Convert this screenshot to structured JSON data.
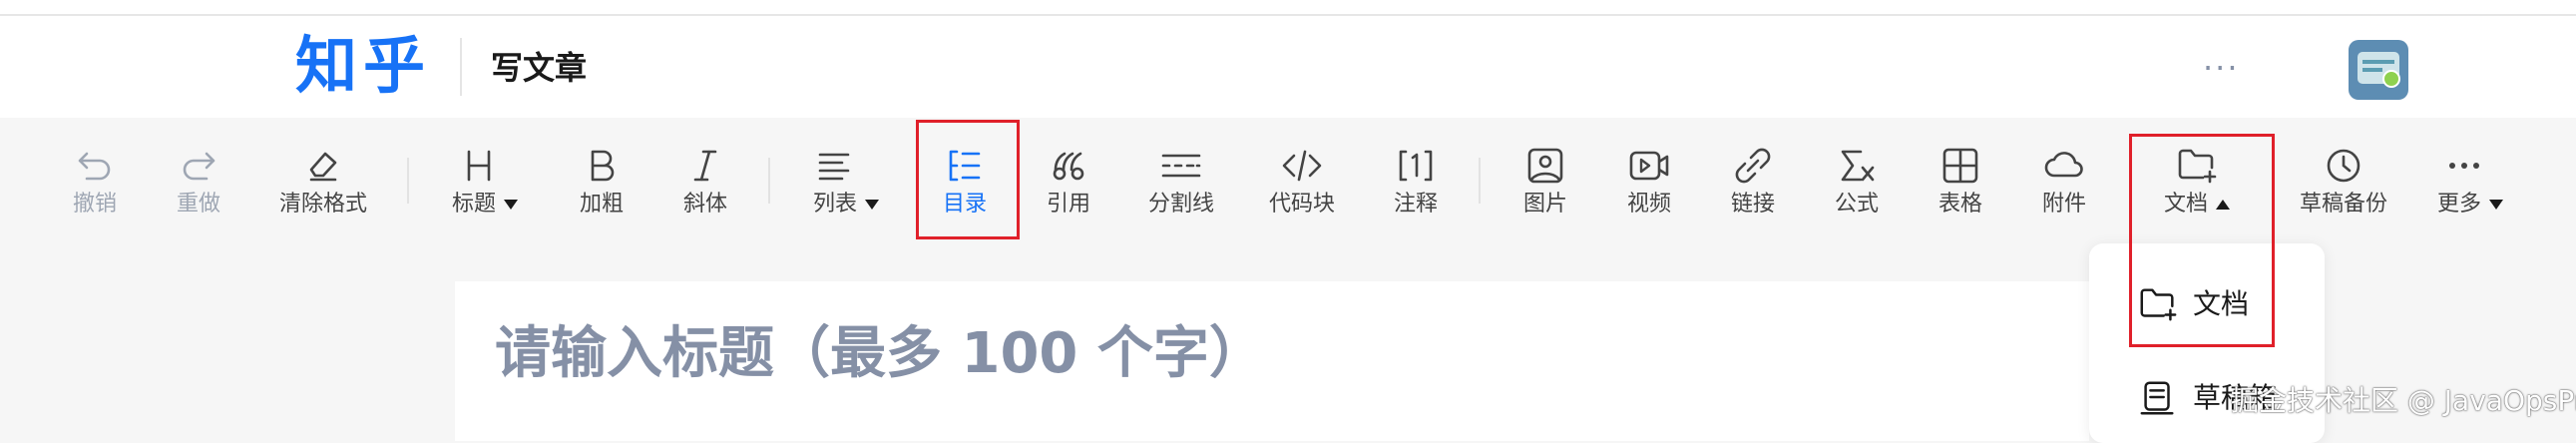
{
  "header": {
    "logo_text": "知乎",
    "page_title": "写文章",
    "more_glyph": "···"
  },
  "toolbar": {
    "undo": "撤销",
    "redo": "重做",
    "clear_format": "清除格式",
    "heading": "标题",
    "bold": "加粗",
    "italic": "斜体",
    "list": "列表",
    "toc": "目录",
    "quote": "引用",
    "divider": "分割线",
    "code_block": "代码块",
    "footnote": "注释",
    "image": "图片",
    "video": "视频",
    "link": "链接",
    "formula": "公式",
    "table": "表格",
    "attachment": "附件",
    "document": "文档",
    "draft_backup": "草稿备份",
    "more": "更多"
  },
  "editor": {
    "title_placeholder": "请输入标题（最多 100 个字）"
  },
  "document_menu": {
    "items": [
      {
        "label": "文档",
        "icon": "folder-add-icon"
      },
      {
        "label": "草稿箱",
        "icon": "drafts-icon"
      }
    ]
  },
  "watermark": "掘金技术社区 @ JavaOpsPro",
  "colors": {
    "brand_blue": "#1772f6",
    "highlight_red": "#e0202a",
    "placeholder_gray": "#8590a6"
  }
}
